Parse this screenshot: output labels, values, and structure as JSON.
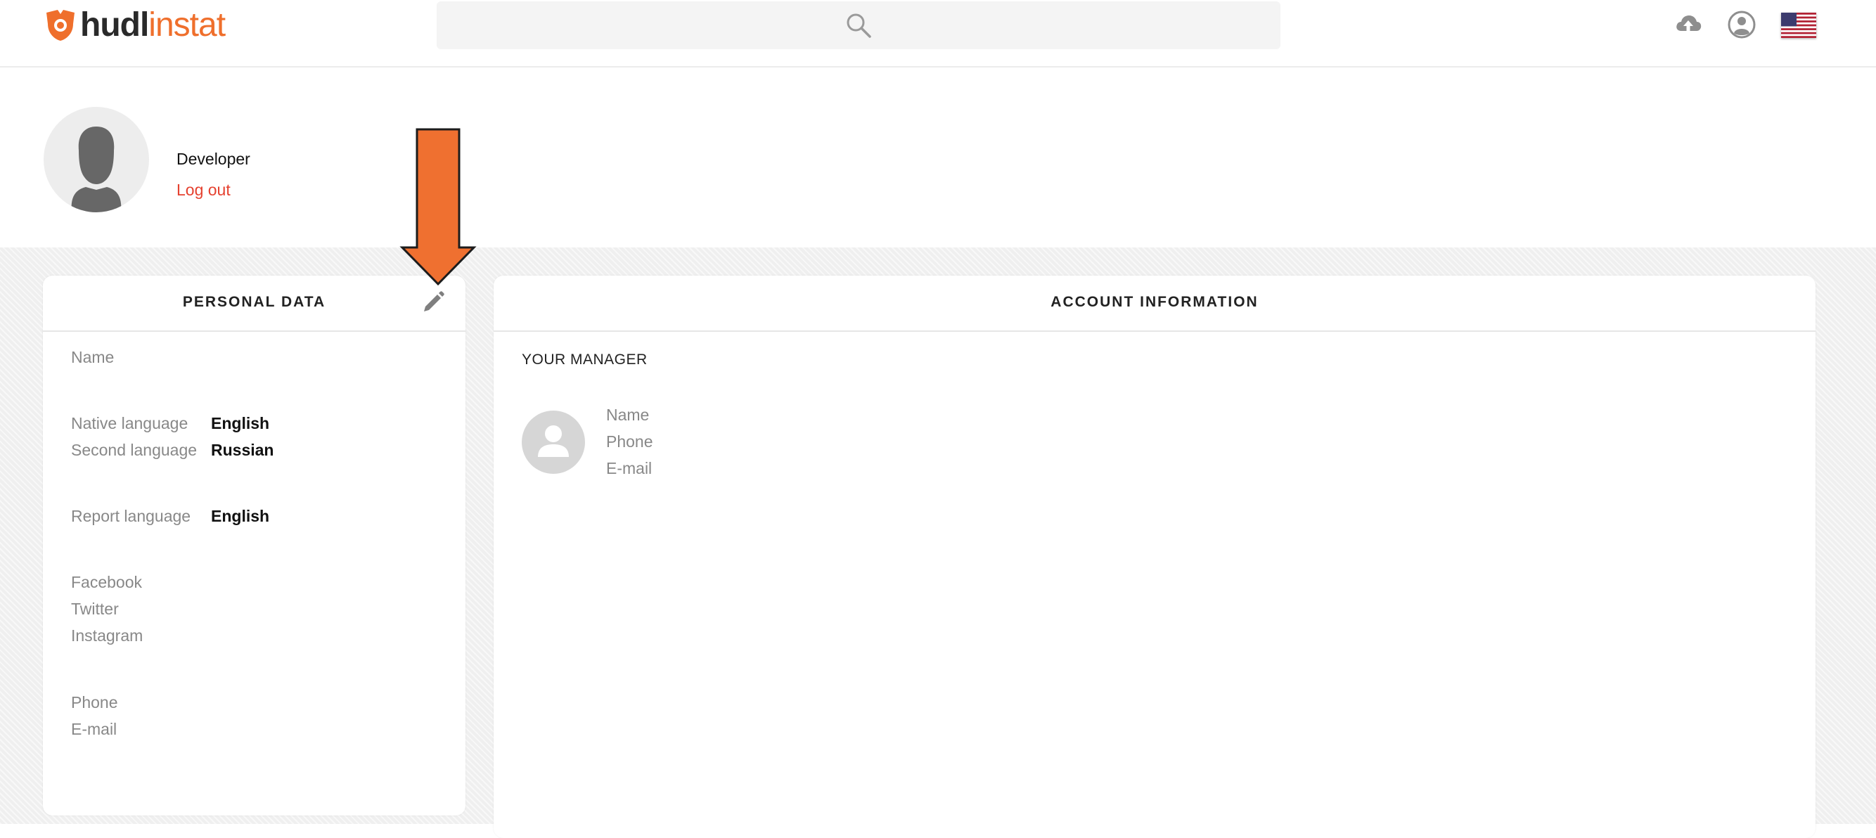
{
  "header": {
    "logo_part1": "hudl",
    "logo_part2": "instat",
    "icons": {
      "search": "search-icon",
      "upload": "cloud-upload-icon",
      "account": "user-circle-icon",
      "language": "us-flag-icon"
    }
  },
  "profile": {
    "username": "Developer",
    "logout_label": "Log out"
  },
  "personal_data": {
    "title": "PERSONAL DATA",
    "edit_icon": "pencil-icon",
    "fields": {
      "name": {
        "label": "Name"
      },
      "native_language": {
        "label": "Native language",
        "value": "English"
      },
      "second_language": {
        "label": "Second language",
        "value": "Russian"
      },
      "report_language": {
        "label": "Report language",
        "value": "English"
      },
      "facebook": {
        "label": "Facebook"
      },
      "twitter": {
        "label": "Twitter"
      },
      "instagram": {
        "label": "Instagram"
      },
      "phone": {
        "label": "Phone"
      },
      "email": {
        "label": "E-mail"
      }
    }
  },
  "account_information": {
    "title": "ACCOUNT INFORMATION",
    "manager_title": "YOUR MANAGER",
    "manager_fields": {
      "name": "Name",
      "phone": "Phone",
      "email": "E-mail"
    }
  },
  "colors": {
    "brand_orange": "#ef6f2c",
    "logout_red": "#e5412f",
    "annotation_arrow": "#ef7030"
  }
}
